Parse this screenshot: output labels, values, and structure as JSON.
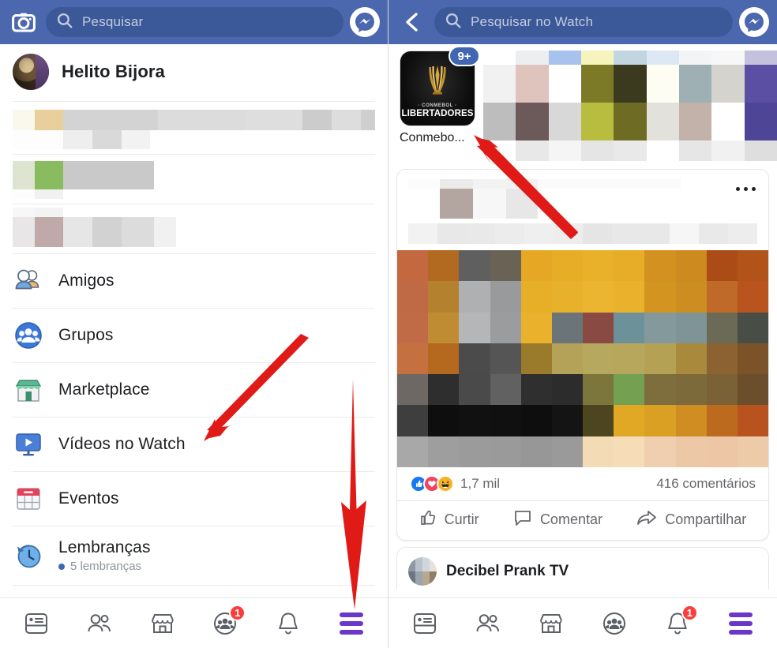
{
  "left": {
    "header": {
      "camera_icon": "camera-icon",
      "search_placeholder": "Pesquisar",
      "messenger_icon": "messenger-icon"
    },
    "profile": {
      "name": "Helito Bijora"
    },
    "menu": [
      {
        "label": "Amigos",
        "icon": "friends-icon",
        "sub": ""
      },
      {
        "label": "Grupos",
        "icon": "groups-icon",
        "sub": ""
      },
      {
        "label": "Marketplace",
        "icon": "marketplace-icon",
        "sub": ""
      },
      {
        "label": "Vídeos no Watch",
        "icon": "watch-video-icon",
        "sub": ""
      },
      {
        "label": "Eventos",
        "icon": "events-icon",
        "sub": ""
      },
      {
        "label": "Lembranças",
        "icon": "memories-icon",
        "sub": "5 lembranças"
      }
    ],
    "bottom_nav": [
      {
        "name": "news-feed-icon",
        "badge": ""
      },
      {
        "name": "friends-icon",
        "badge": ""
      },
      {
        "name": "marketplace-icon",
        "badge": ""
      },
      {
        "name": "groups-icon",
        "badge": "1"
      },
      {
        "name": "notifications-bell-icon",
        "badge": ""
      },
      {
        "name": "menu-hamburger-icon",
        "badge": ""
      }
    ]
  },
  "right": {
    "header": {
      "back_icon": "back-chevron-icon",
      "search_placeholder": "Pesquisar no Watch",
      "messenger_icon": "messenger-icon"
    },
    "story": {
      "badge": "9+",
      "title_line1": "· CONMEBOL ·",
      "title_line2": "LIBERTADORES",
      "name": "Conmebo..."
    },
    "post": {
      "more_icon": "more-options-icon",
      "reactions": [
        "like-icon",
        "love-icon",
        "haha-icon"
      ],
      "reaction_count": "1,7 mil",
      "comments": "416 comentários",
      "actions": [
        {
          "label": "Curtir",
          "icon": "thumbs-up-icon"
        },
        {
          "label": "Comentar",
          "icon": "comment-bubble-icon"
        },
        {
          "label": "Compartilhar",
          "icon": "share-arrow-icon"
        }
      ]
    },
    "next_post": {
      "page_name": "Decibel Prank TV"
    },
    "bottom_nav": [
      {
        "name": "news-feed-icon",
        "badge": ""
      },
      {
        "name": "friends-icon",
        "badge": ""
      },
      {
        "name": "marketplace-icon",
        "badge": ""
      },
      {
        "name": "groups-icon",
        "badge": ""
      },
      {
        "name": "notifications-bell-icon",
        "badge": "1"
      },
      {
        "name": "menu-hamburger-icon",
        "badge": ""
      }
    ]
  },
  "colors": {
    "fb_blue": "#4b67ad",
    "search_pill": "#3b5998",
    "accent_purple": "#6b37c9",
    "badge_red": "#fa3e3e",
    "annotation_red": "#e01b17"
  }
}
